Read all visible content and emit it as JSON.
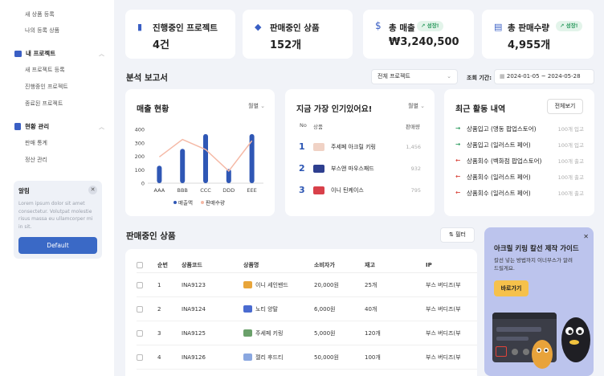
{
  "sidebar": {
    "top_items": [
      "새 상품 등록",
      "나의 등록 상품"
    ],
    "groups": [
      {
        "label": "내 프로젝트",
        "items": [
          "새 프로젝트 등록",
          "진행중인 프로젝트",
          "종료된 프로젝트"
        ]
      },
      {
        "label": "현황 관리",
        "items": [
          "판매 통계",
          "정산 관리"
        ]
      }
    ],
    "alert": {
      "title": "알림",
      "body": "Lorem ipsum dolor sit amet consectetur. Volutpat molestie risus massa eu ullamcorper mi in sit.",
      "button": "Default"
    }
  },
  "stats": [
    {
      "label": "진행중인 프로젝트",
      "value": "4건",
      "icon": "doc-icon"
    },
    {
      "label": "판매중인 상품",
      "value": "152개",
      "icon": "tag-icon"
    },
    {
      "label": "총 매출",
      "value": "₩3,240,500",
      "badge": "성장!",
      "icon": "dollar-icon"
    },
    {
      "label": "총 판매수량",
      "value": "4,955개",
      "badge": "성장!",
      "icon": "box-icon"
    }
  ],
  "report": {
    "title": "분석 보고서",
    "project_select": "전체 프로젝트",
    "period_label": "조회 기간:",
    "date_from": "2024-01-05",
    "date_to": "2024-05-28"
  },
  "sales_chart": {
    "title": "매출 현황",
    "period": "월별",
    "legend_sales": "매출액",
    "legend_qty": "판매수량"
  },
  "chart_data": {
    "type": "bar",
    "categories": [
      "AAA",
      "BBB",
      "CCC",
      "DDD",
      "EEE"
    ],
    "series": [
      {
        "name": "매출액",
        "type": "bar",
        "values": [
          130,
          255,
          365,
          105,
          365
        ]
      },
      {
        "name": "판매수량",
        "type": "line",
        "values": [
          195,
          325,
          250,
          90,
          315
        ]
      }
    ],
    "ylim": [
      0,
      400
    ],
    "yticks": [
      0,
      100,
      200,
      300,
      400
    ],
    "colors": {
      "bar": "#2f57b5",
      "line": "#f5b9a6"
    }
  },
  "popular": {
    "title": "지금 가장 인기있어요!",
    "period": "월별",
    "headers": {
      "no": "No",
      "product": "상품",
      "count": "판매량"
    },
    "rows": [
      {
        "rank": "1",
        "name": "주세페 아크릴 키링",
        "count": "1,456"
      },
      {
        "rank": "2",
        "name": "부스앤 마우스패드",
        "count": "932"
      },
      {
        "rank": "3",
        "name": "이니 틴케이스",
        "count": "795"
      }
    ]
  },
  "activity": {
    "title": "최근 활동 내역",
    "button": "전체보기",
    "rows": [
      {
        "text": "상품입고 (앵동 팝업스토어)",
        "qty": "100개 입고",
        "dir": "in"
      },
      {
        "text": "상품입고 (일러스트 페어)",
        "qty": "100개 입고",
        "dir": "in"
      },
      {
        "text": "상품회수 (벡화점 팝업스토어)",
        "qty": "100개 출고",
        "dir": "out"
      },
      {
        "text": "상품회수 (일러스트 페어)",
        "qty": "100개 출고",
        "dir": "out"
      },
      {
        "text": "상품회수 (일러스트 페어)",
        "qty": "100개 출고",
        "dir": "out"
      }
    ]
  },
  "products": {
    "title": "판매중인 상품",
    "filter": "필터",
    "headers": [
      "순번",
      "상품코드",
      "상품명",
      "소비자가",
      "재고",
      "IP"
    ],
    "rows": [
      {
        "no": "1",
        "code": "INA9123",
        "name": "이니 세인밴드",
        "price": "20,000원",
        "stock": "25개",
        "ip": "부스 버디즈(부"
      },
      {
        "no": "2",
        "code": "INA9124",
        "name": "노티 양말",
        "price": "6,000원",
        "stock": "40개",
        "ip": "부스 버디즈(부"
      },
      {
        "no": "3",
        "code": "INA9125",
        "name": "주세페 키링",
        "price": "5,000원",
        "stock": "120개",
        "ip": "부스 버디즈(부"
      },
      {
        "no": "4",
        "code": "INA9126",
        "name": "젤리 후드티",
        "price": "50,000원",
        "stock": "100개",
        "ip": "부스 버디즈(부"
      }
    ]
  },
  "promo": {
    "title": "아크릴 키링 칼선 제작 가이드",
    "desc": "칼선 넣는 방법까지 이너부스가 알려드릴게요.",
    "button": "바로가기"
  }
}
